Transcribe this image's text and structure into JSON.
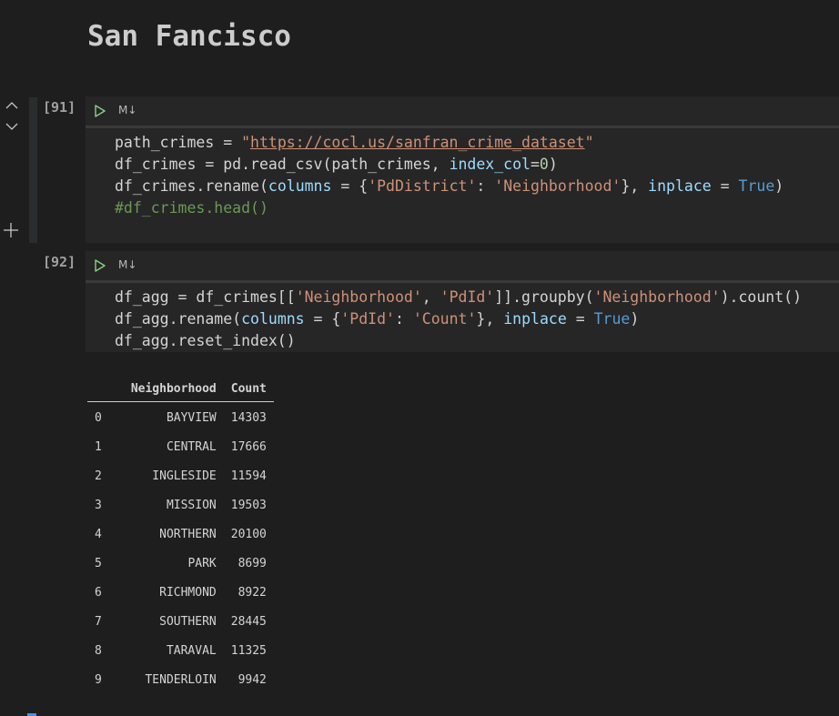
{
  "markdown": {
    "title": "San Fancisco"
  },
  "cells": [
    {
      "exec_count": "[91]",
      "badge": "M↓",
      "code": [
        [
          {
            "t": "path_crimes = ",
            "c": ""
          },
          {
            "t": "\"",
            "c": "s"
          },
          {
            "t": "https://cocl.us/sanfran_crime_dataset",
            "c": "u"
          },
          {
            "t": "\"",
            "c": "s"
          }
        ],
        [
          {
            "t": "df_crimes = pd.read_csv(path_crimes, ",
            "c": ""
          },
          {
            "t": "index_col",
            "c": "p"
          },
          {
            "t": "=",
            "c": ""
          },
          {
            "t": "0",
            "c": "n"
          },
          {
            "t": ")",
            "c": ""
          }
        ],
        [
          {
            "t": "df_crimes.rename(",
            "c": ""
          },
          {
            "t": "columns",
            "c": "p"
          },
          {
            "t": " = {",
            "c": ""
          },
          {
            "t": "'PdDistrict'",
            "c": "s"
          },
          {
            "t": ": ",
            "c": ""
          },
          {
            "t": "'Neighborhood'",
            "c": "s"
          },
          {
            "t": "}, ",
            "c": ""
          },
          {
            "t": "inplace",
            "c": "p"
          },
          {
            "t": " = ",
            "c": ""
          },
          {
            "t": "True",
            "c": "k"
          },
          {
            "t": ")",
            "c": ""
          }
        ],
        [
          {
            "t": "#df_crimes.head()",
            "c": "c"
          }
        ]
      ]
    },
    {
      "exec_count": "[92]",
      "badge": "M↓",
      "code": [
        [
          {
            "t": "df_agg = df_crimes[[",
            "c": ""
          },
          {
            "t": "'Neighborhood'",
            "c": "s"
          },
          {
            "t": ", ",
            "c": ""
          },
          {
            "t": "'PdId'",
            "c": "s"
          },
          {
            "t": "]].groupby(",
            "c": ""
          },
          {
            "t": "'Neighborhood'",
            "c": "s"
          },
          {
            "t": ").count()",
            "c": ""
          }
        ],
        [
          {
            "t": "df_agg.rename(",
            "c": ""
          },
          {
            "t": "columns",
            "c": "p"
          },
          {
            "t": " = {",
            "c": ""
          },
          {
            "t": "'PdId'",
            "c": "s"
          },
          {
            "t": ": ",
            "c": ""
          },
          {
            "t": "'Count'",
            "c": "s"
          },
          {
            "t": "}, ",
            "c": ""
          },
          {
            "t": "inplace",
            "c": "p"
          },
          {
            "t": " = ",
            "c": ""
          },
          {
            "t": "True",
            "c": "k"
          },
          {
            "t": ")",
            "c": ""
          }
        ],
        [
          {
            "t": "df_agg.reset_index()",
            "c": ""
          }
        ]
      ]
    }
  ],
  "output_table": {
    "columns": [
      "",
      "Neighborhood",
      "Count"
    ],
    "rows": [
      [
        "0",
        "BAYVIEW",
        "14303"
      ],
      [
        "1",
        "CENTRAL",
        "17666"
      ],
      [
        "2",
        "INGLESIDE",
        "11594"
      ],
      [
        "3",
        "MISSION",
        "19503"
      ],
      [
        "4",
        "NORTHERN",
        "20100"
      ],
      [
        "5",
        "PARK",
        "8699"
      ],
      [
        "6",
        "RICHMOND",
        "8922"
      ],
      [
        "7",
        "SOUTHERN",
        "28445"
      ],
      [
        "8",
        "TARAVAL",
        "11325"
      ],
      [
        "9",
        "TENDERLOIN",
        "9942"
      ]
    ]
  },
  "colors": {
    "background": "#1e1e1e",
    "cell_bg": "#262626",
    "run_icon": "#89d185",
    "string": "#ce9178",
    "param": "#9cdcfe",
    "keyword": "#569cd6",
    "number": "#b5cea8",
    "comment": "#6a9955"
  },
  "icons": {
    "collapse_up": "chevron-up-icon",
    "collapse_down": "chevron-down-icon",
    "add_cell": "plus-icon",
    "run": "run-icon"
  }
}
